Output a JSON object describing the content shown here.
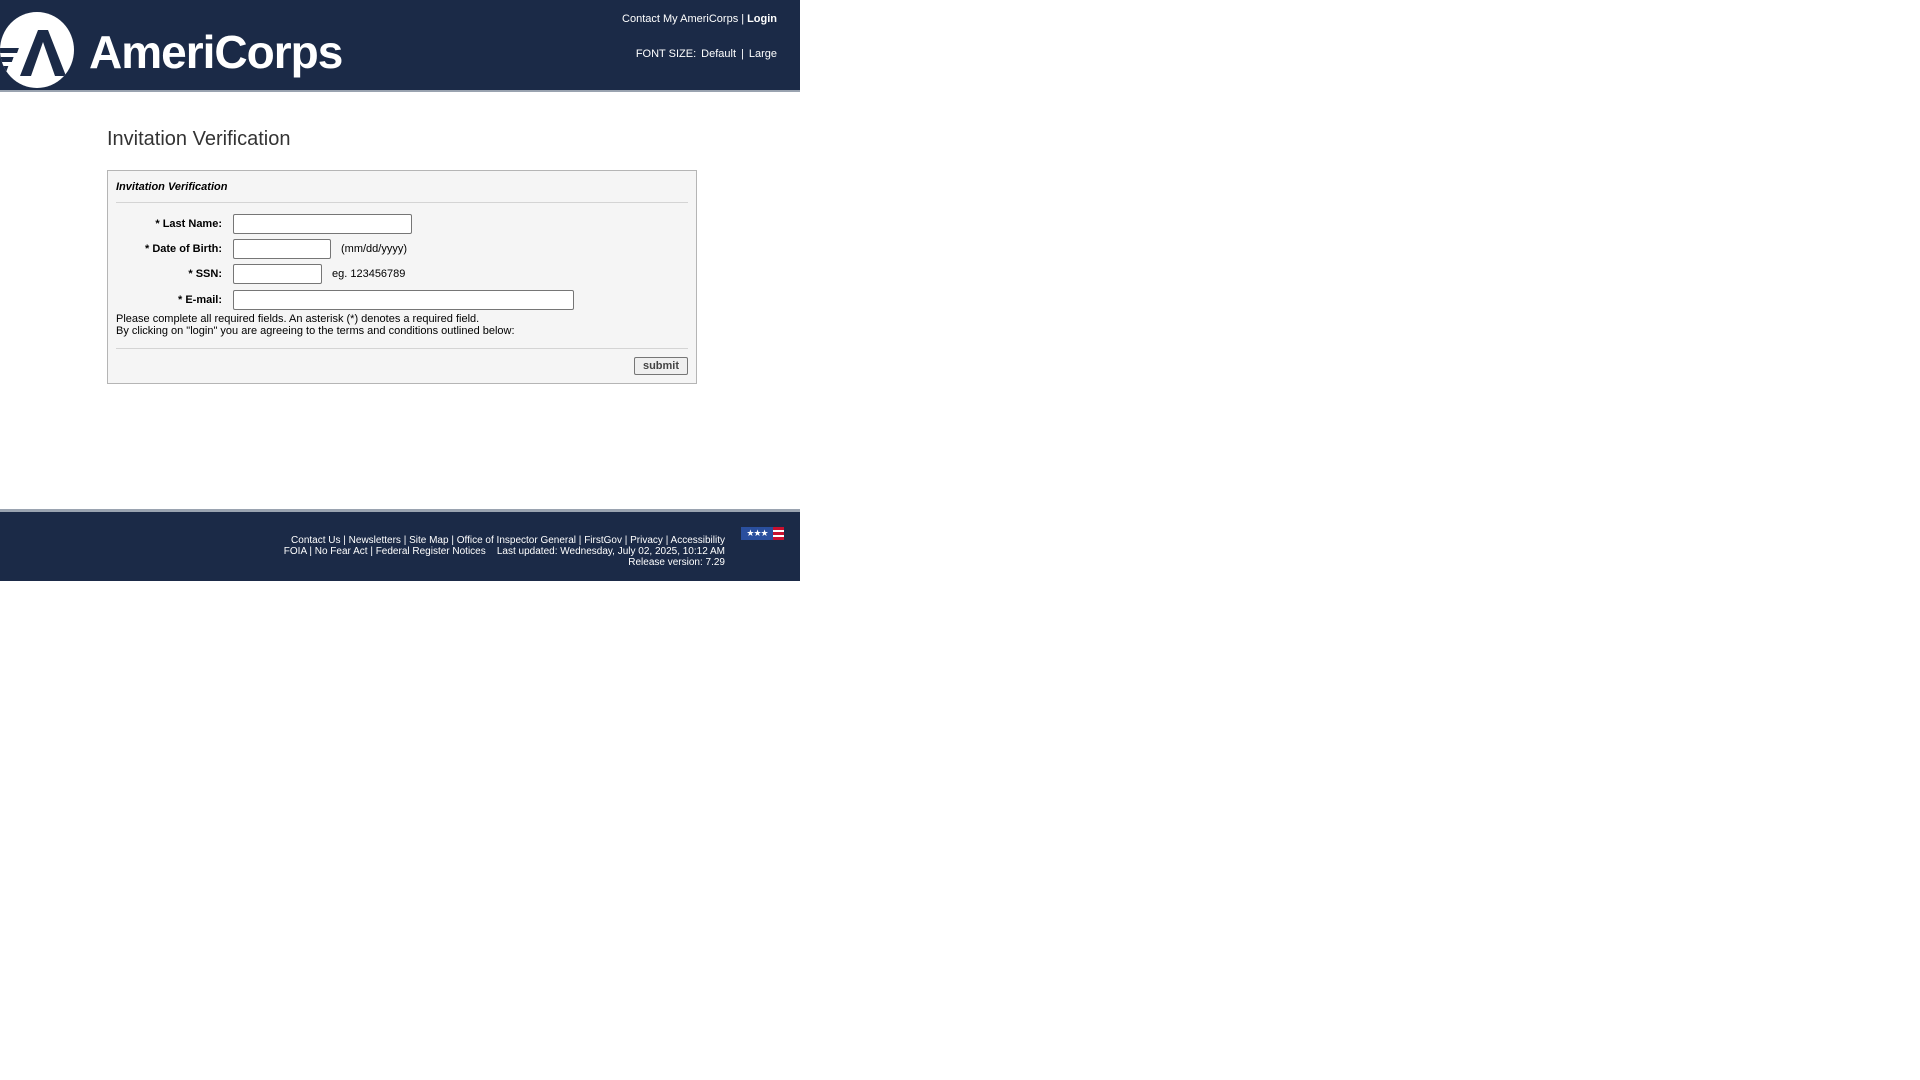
{
  "header": {
    "logo_text": "AmeriCorps",
    "contact_link": "Contact My AmeriCorps",
    "separator": "|",
    "login_link": "Login",
    "font_size_label": "FONT SIZE:",
    "font_default": "Default",
    "font_large": "Large"
  },
  "page": {
    "title": "Invitation Verification"
  },
  "form": {
    "panel_title": "Invitation Verification",
    "fields": {
      "last_name": {
        "label": "* Last Name:",
        "value": ""
      },
      "dob": {
        "label": "* Date of Birth:",
        "value": "",
        "hint": "(mm/dd/yyyy)"
      },
      "ssn": {
        "label": "* SSN:",
        "value": "",
        "hint": "eg. 123456789"
      },
      "email": {
        "label": "* E-mail:",
        "value": ""
      }
    },
    "note_required": "Please complete all required fields. An asterisk (*) denotes a required field.",
    "note_terms": "By clicking on \"login\" you are agreeing to the terms and conditions outlined below:",
    "submit_label": "submit"
  },
  "footer": {
    "links_row1": [
      "Contact Us",
      "Newsletters",
      "Site Map",
      "Office of Inspector General",
      "FirstGov",
      "Privacy",
      "Accessibility"
    ],
    "links_row2": [
      "FOIA",
      "No Fear Act",
      "Federal Register Notices"
    ],
    "last_updated": "Last updated: Wednesday, July 02, 2025, 10:12 AM",
    "release_version": "Release version: 7.29",
    "flag_icon": "us-flag-icon",
    "colors": {
      "navy": "#1b2a47",
      "flag_blue": "#2a4f9e",
      "flag_red": "#c8102e"
    }
  }
}
